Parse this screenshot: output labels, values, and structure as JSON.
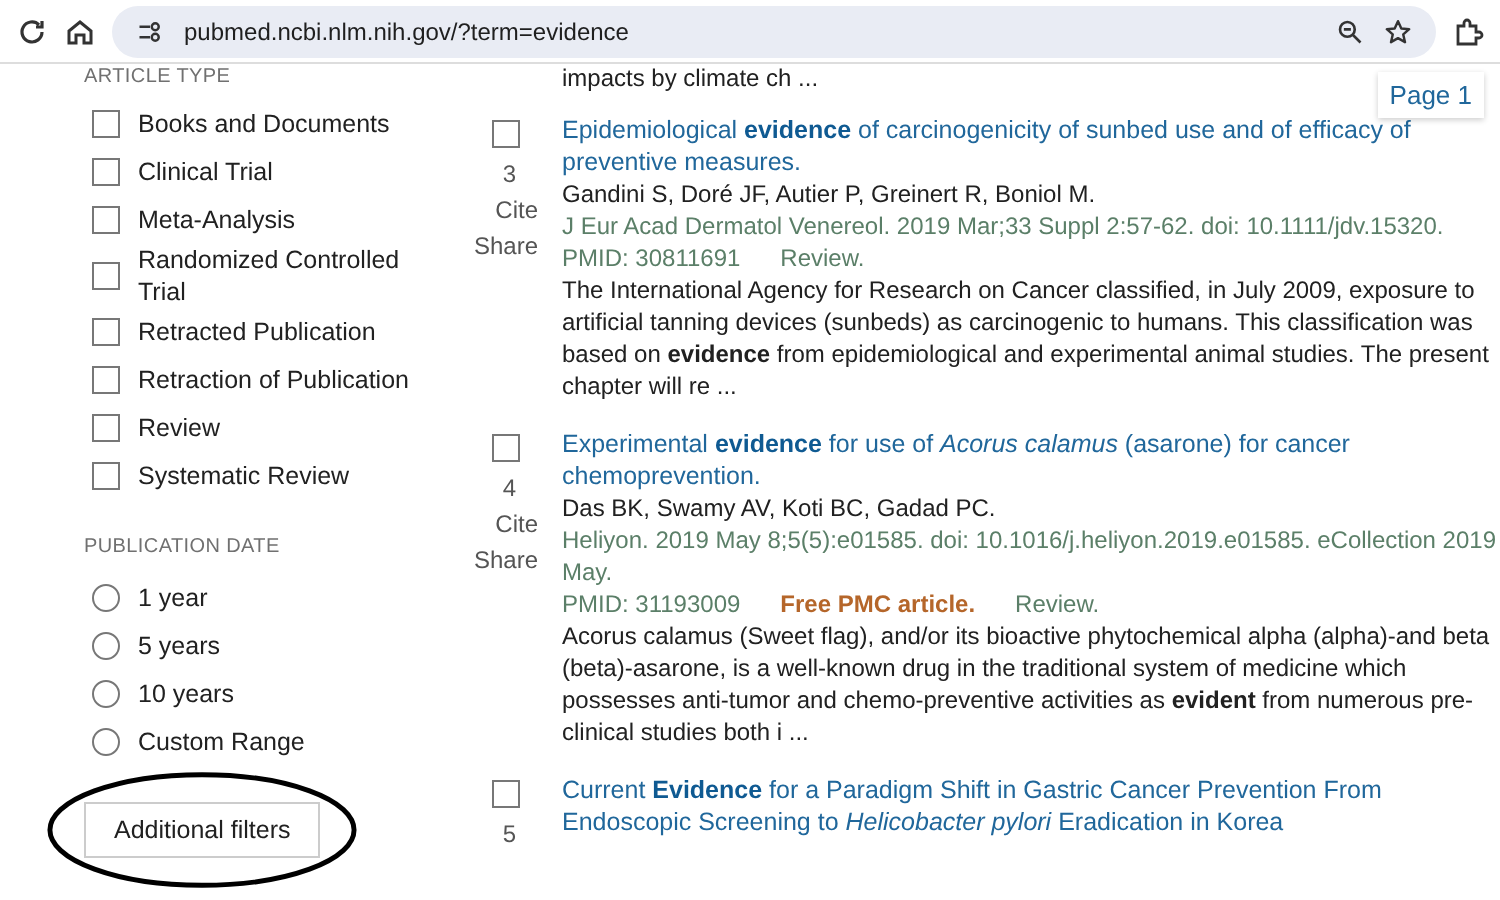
{
  "browser": {
    "url": "pubmed.ncbi.nlm.nih.gov/?term=evidence"
  },
  "pager": {
    "label": "Page 1"
  },
  "sidebar": {
    "sections": [
      {
        "heading": "ARTICLE TYPE",
        "kind": "checkbox",
        "options": [
          {
            "label": "Books and Documents",
            "checked": false
          },
          {
            "label": "Clinical Trial",
            "checked": false
          },
          {
            "label": "Meta-Analysis",
            "checked": false
          },
          {
            "label": "Randomized Controlled Trial",
            "checked": false
          },
          {
            "label": "Retracted Publication",
            "checked": false
          },
          {
            "label": "Retraction of Publication",
            "checked": false
          },
          {
            "label": "Review",
            "checked": false
          },
          {
            "label": "Systematic Review",
            "checked": false
          }
        ]
      },
      {
        "heading": "PUBLICATION DATE",
        "kind": "radio",
        "options": [
          {
            "label": "1 year",
            "selected": false
          },
          {
            "label": "5 years",
            "selected": false
          },
          {
            "label": "10 years",
            "selected": false
          },
          {
            "label": "Custom Range",
            "selected": false
          }
        ]
      }
    ],
    "button": "Additional filters"
  },
  "results": {
    "previous_snippet": "impacts by climate ch ...",
    "items": [
      {
        "number": "3",
        "selected": false,
        "actions": [
          "Cite",
          "Share"
        ],
        "title": "Epidemiological **evidence** of carcinogenicity of sunbed use and of efficacy of preventive measures.",
        "authors": "Gandini S, Doré JF, Autier P, Greinert R, Boniol M.",
        "citation": "J Eur Acad Dermatol Venereol. 2019 Mar;33 Suppl 2:57-62. doi: 10.1111/jdv.15320.",
        "pmid": "PMID: 30811691",
        "type": "Review.",
        "snippet": "The International Agency for Research on Cancer classified, in July 2009, exposure to artificial tanning devices (sunbeds) as carcinogenic to humans. This classification was based on **evidence** from epidemiological and experimental animal studies. The present chapter will re ..."
      },
      {
        "number": "4",
        "selected": false,
        "actions": [
          "Cite",
          "Share"
        ],
        "title": "Experimental **evidence** for use of *Acorus calamus* (asarone) for cancer chemoprevention.",
        "authors": "Das BK, Swamy AV, Koti BC, Gadad PC.",
        "citation": "Heliyon. 2019 May 8;5(5):e01585. doi: 10.1016/j.heliyon.2019.e01585. eCollection 2019 May.",
        "pmid": "PMID: 31193009",
        "free": "Free PMC article.",
        "type": "Review.",
        "snippet": "Acorus calamus (Sweet flag), and/or its bioactive phytochemical alpha (alpha)-and beta (beta)-asarone, is a well-known drug in the traditional system of medicine which possesses anti-tumor and chemo-preventive activities as **evident** from numerous pre-clinical studies both i ..."
      },
      {
        "number": "5",
        "selected": false,
        "title": "Current **Evidence** for a Paradigm Shift in Gastric Cancer Prevention From Endoscopic Screening to *Helicobacter pylori* Eradication in Korea"
      }
    ]
  }
}
